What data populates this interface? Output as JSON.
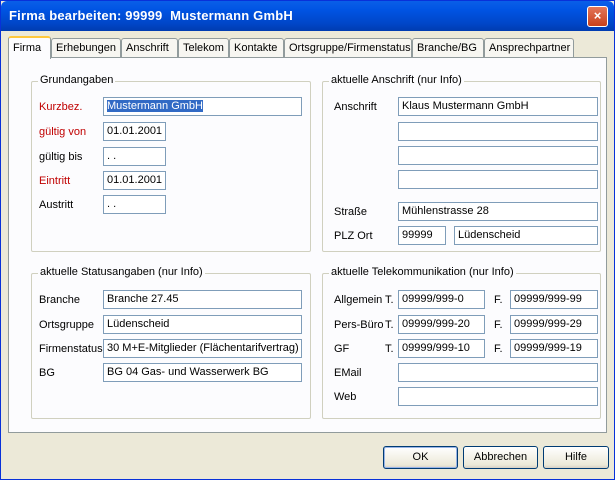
{
  "window": {
    "title": "Firma bearbeiten: 99999  Mustermann GmbH",
    "close_glyph": "×"
  },
  "tabs": [
    {
      "label": "Firma"
    },
    {
      "label": "Erhebungen"
    },
    {
      "label": "Anschrift"
    },
    {
      "label": "Telekom"
    },
    {
      "label": "Kontakte"
    },
    {
      "label": "Ortsgruppe/Firmenstatus"
    },
    {
      "label": "Branche/BG"
    },
    {
      "label": "Ansprechpartner"
    }
  ],
  "grundangaben": {
    "title": "Grundangaben",
    "kurzbez_label": "Kurzbez.",
    "kurzbez_value": "Mustermann GmbH",
    "gueltig_von_label": "gültig von",
    "gueltig_von_value": "01.01.2001",
    "gueltig_bis_label": "gültig bis",
    "gueltig_bis_value": " .  .",
    "eintritt_label": "Eintritt",
    "eintritt_value": "01.01.2001",
    "austritt_label": "Austritt",
    "austritt_value": " .  ."
  },
  "anschrift": {
    "title": "aktuelle Anschrift (nur Info)",
    "anschrift_label": "Anschrift",
    "line1": "Klaus Mustermann GmbH",
    "line2": "",
    "line3": "",
    "line4": "",
    "strasse_label": "Straße",
    "strasse_value": "Mühlenstrasse 28",
    "plz_ort_label": "PLZ Ort",
    "plz_value": "99999",
    "ort_value": "Lüdenscheid"
  },
  "status": {
    "title": "aktuelle Statusangaben (nur Info)",
    "branche_label": "Branche",
    "branche_value": "Branche 27.45",
    "ortsgruppe_label": "Ortsgruppe",
    "ortsgruppe_value": "Lüdenscheid",
    "firmenstatus_label": "Firmenstatus",
    "firmenstatus_value": "30 M+E-Mitglieder (Flächentarifvertrag)",
    "bg_label": "BG",
    "bg_value": "BG 04  Gas- und Wasserwerk BG"
  },
  "telekom": {
    "title": "aktuelle Telekommunikation (nur Info)",
    "t_label": "T.",
    "f_label": "F.",
    "allgemein_label": "Allgemein",
    "allgemein_t": "09999/999-0",
    "allgemein_f": "09999/999-99",
    "persbuero_label": "Pers-Büro",
    "persbuero_t": "09999/999-20",
    "persbuero_f": "09999/999-29",
    "gf_label": "GF",
    "gf_t": "09999/999-10",
    "gf_f": "09999/999-19",
    "email_label": "EMail",
    "email_value": "",
    "web_label": "Web",
    "web_value": ""
  },
  "buttons": {
    "ok": "OK",
    "abbrechen": "Abbrechen",
    "hilfe": "Hilfe"
  }
}
